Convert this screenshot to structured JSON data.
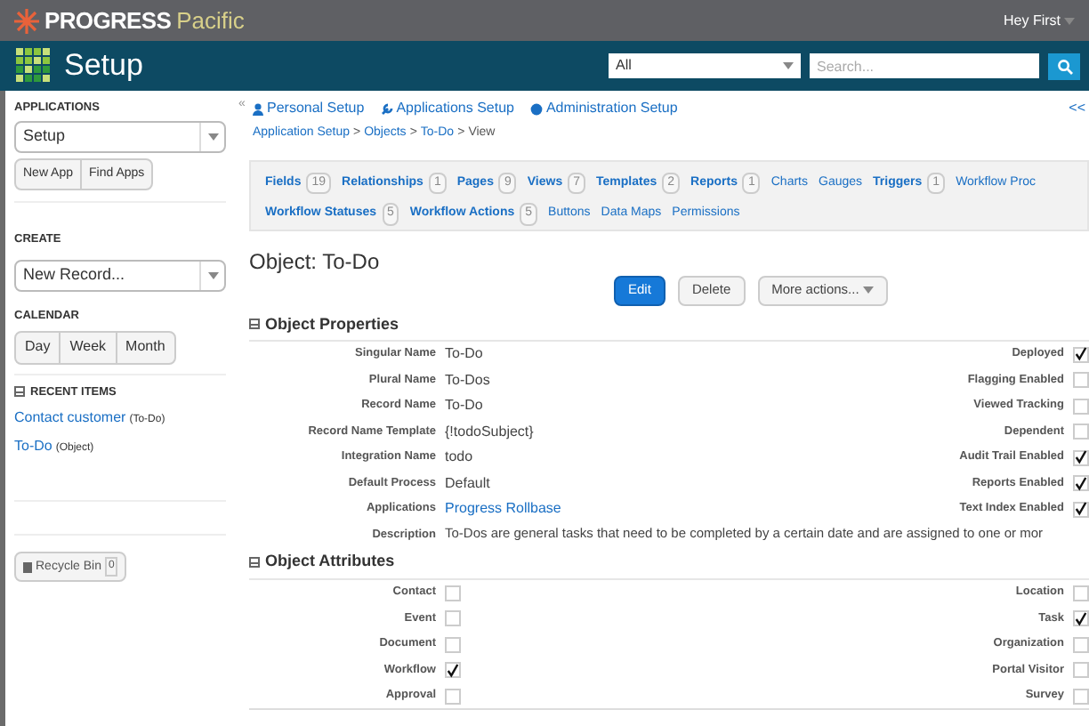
{
  "header": {
    "brand": "PROGRESS",
    "product": "Pacific",
    "user": "Hey First"
  },
  "appbar": {
    "title": "Setup",
    "scope": "All",
    "search": {
      "placeholder": "Search..."
    }
  },
  "sidebar": {
    "applications": {
      "heading": "APPLICATIONS",
      "value": "Setup",
      "buttons": [
        "New App",
        "Find Apps"
      ]
    },
    "create": {
      "heading": "CREATE",
      "value": "New Record..."
    },
    "calendar": {
      "heading": "CALENDAR",
      "buttons": [
        "Day",
        "Week",
        "Month"
      ]
    },
    "recent": {
      "heading": "RECENT ITEMS",
      "items": [
        {
          "name": "Contact customer",
          "type": "(To-Do)"
        },
        {
          "name": "To-Do",
          "type": "(Object)"
        }
      ]
    },
    "recycle": {
      "label": "Recycle Bin",
      "count": "0"
    },
    "collapse": "«"
  },
  "nav": {
    "links": [
      "Personal Setup",
      "Applications Setup",
      "Administration Setup"
    ],
    "collapse": "<<",
    "breadcrumb": [
      {
        "label": "Application Setup",
        "link": true
      },
      {
        "label": ">",
        "link": false
      },
      {
        "label": "Objects",
        "link": true
      },
      {
        "label": ">",
        "link": false
      },
      {
        "label": "To-Do",
        "link": true
      },
      {
        "label": ">",
        "link": false
      },
      {
        "label": "View",
        "link": false
      }
    ]
  },
  "tabs": [
    [
      {
        "label": "Fields",
        "count": "19"
      },
      {
        "label": "Relationships",
        "count": "1"
      },
      {
        "label": "Pages",
        "count": "9"
      },
      {
        "label": "Views",
        "count": "7"
      },
      {
        "label": "Templates",
        "count": "2"
      },
      {
        "label": "Reports",
        "count": "1"
      },
      {
        "label": "Charts"
      },
      {
        "label": "Gauges"
      },
      {
        "label": "Triggers",
        "count": "1"
      },
      {
        "label": "Workflow Proc"
      }
    ],
    [
      {
        "label": "Workflow Statuses",
        "count": "5"
      },
      {
        "label": "Workflow Actions",
        "count": "5"
      },
      {
        "label": "Buttons"
      },
      {
        "label": "Data Maps"
      },
      {
        "label": "Permissions"
      }
    ]
  ],
  "object": {
    "title": "Object: To-Do",
    "buttons": [
      {
        "label": "Edit",
        "kind": "primary"
      },
      {
        "label": "Delete",
        "kind": "default"
      },
      {
        "label": "More actions...",
        "kind": "menu"
      }
    ]
  },
  "properties": {
    "heading": "Object Properties",
    "fields": [
      {
        "label": "Singular Name",
        "value": "To-Do",
        "kind": "text"
      },
      {
        "label": "Plural Name",
        "value": "To-Dos",
        "kind": "text"
      },
      {
        "label": "Record Name",
        "value": "To-Do",
        "kind": "text"
      },
      {
        "label": "Record Name Template",
        "value": "{!todoSubject}",
        "kind": "text"
      },
      {
        "label": "Integration Name",
        "value": "todo",
        "kind": "text"
      },
      {
        "label": "Default Process",
        "value": "Default",
        "kind": "text"
      },
      {
        "label": "Applications",
        "value": "Progress Rollbase",
        "kind": "link"
      }
    ],
    "flags": [
      {
        "label": "Deployed",
        "checked": true
      },
      {
        "label": "Flagging Enabled",
        "checked": false
      },
      {
        "label": "Viewed Tracking",
        "checked": false
      },
      {
        "label": "Dependent",
        "checked": false
      },
      {
        "label": "Audit Trail Enabled",
        "checked": true
      },
      {
        "label": "Reports Enabled",
        "checked": true
      },
      {
        "label": "Text Index Enabled",
        "checked": true
      }
    ],
    "description": {
      "label": "Description",
      "value": "To-Dos are general tasks that need to be completed by a certain date and are assigned to one or mor"
    }
  },
  "attributes": {
    "heading": "Object Attributes",
    "left": [
      {
        "label": "Contact",
        "checked": false
      },
      {
        "label": "Event",
        "checked": false
      },
      {
        "label": "Document",
        "checked": false
      },
      {
        "label": "Workflow",
        "checked": true
      },
      {
        "label": "Approval",
        "checked": false
      }
    ],
    "right": [
      {
        "label": "Location",
        "checked": false
      },
      {
        "label": "Task",
        "checked": true
      },
      {
        "label": "Organization",
        "checked": false
      },
      {
        "label": "Portal Visitor",
        "checked": false
      },
      {
        "label": "Survey",
        "checked": false
      }
    ]
  }
}
